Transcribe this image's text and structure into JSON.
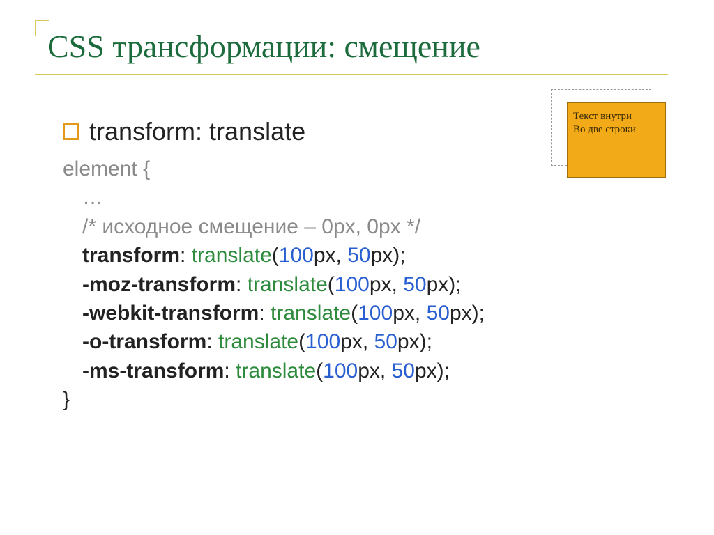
{
  "title": "CSS трансформации: смещение",
  "bullet": "transform: translate",
  "box": {
    "line1": "Текст внутри",
    "line2": "Во две строки"
  },
  "code": {
    "selector_open": "element {",
    "ellipsis": "…",
    "comment": "/* исходное смещение – 0px, 0px */",
    "close": "}",
    "func": "translate",
    "open_paren": "(",
    "close_paren": ")",
    "semicolon": ";",
    "colon": ":",
    "comma": ",",
    "unit": "px",
    "val1": "100",
    "val2": "50",
    "props": {
      "p1": "transform",
      "p2": "-moz-transform",
      "p3": "-webkit-transform",
      "p4": "-o-transform",
      "p5": "-ms-transform"
    }
  }
}
